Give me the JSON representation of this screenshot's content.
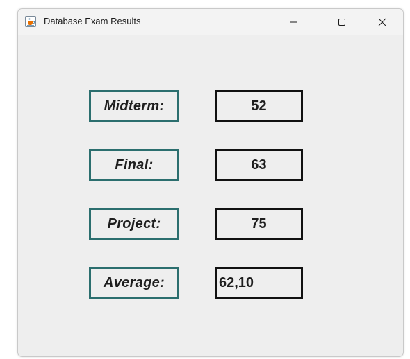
{
  "window": {
    "title": "Database Exam Results",
    "icon": "java-cup-icon"
  },
  "controls": {
    "minimize_icon": "minimize-icon",
    "maximize_icon": "maximize-icon",
    "close_icon": "close-icon"
  },
  "rows": [
    {
      "label": "Midterm:",
      "value": "52"
    },
    {
      "label": "Final:",
      "value": "63"
    },
    {
      "label": "Project:",
      "value": "75"
    },
    {
      "label": "Average:",
      "value": "62,10"
    }
  ],
  "colors": {
    "label_border": "#2b6e6e",
    "value_border": "#111111",
    "background": "#eeeeee"
  }
}
